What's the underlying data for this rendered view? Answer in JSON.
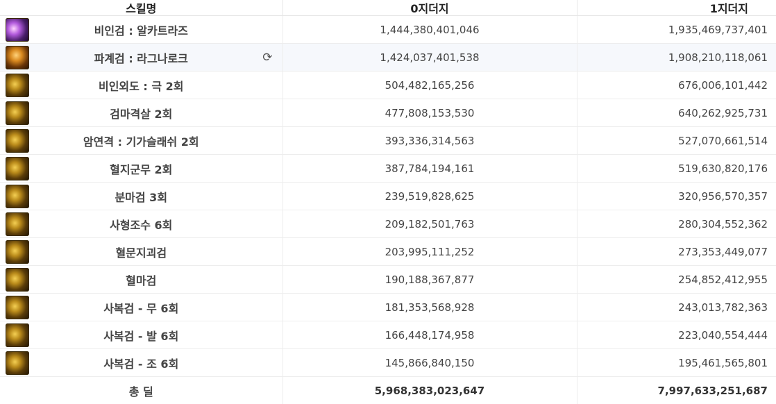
{
  "header": {
    "col_skill": "스킬명",
    "col_dist0": "0지더지",
    "col_dist1": "1지더지"
  },
  "rows": [
    {
      "name": "비인검 : 알카트라즈",
      "icon": "purple-sword-icon",
      "v0": "1,444,380,401,046",
      "v1": "1,935,469,737,401"
    },
    {
      "name": "파계검 : 라그나로크",
      "icon": "ragnarok-icon",
      "v0": "1,424,037,401,538",
      "v1": "1,908,210,118,061"
    },
    {
      "name": "비인외도 : 극 2회",
      "icon": "gold-slash-icon",
      "v0": "504,482,165,256",
      "v1": "676,006,101,442"
    },
    {
      "name": "검마격살 2회",
      "icon": "gold-claw-icon",
      "v0": "477,808,153,530",
      "v1": "640,262,925,731"
    },
    {
      "name": "암연격 : 기가슬래쉬 2회",
      "icon": "gold-dash-icon",
      "v0": "393,336,314,563",
      "v1": "527,070,661,514"
    },
    {
      "name": "혈지군무 2회",
      "icon": "gold-burst-icon",
      "v0": "387,784,194,161",
      "v1": "519,630,820,176"
    },
    {
      "name": "분마검 3회",
      "icon": "gold-blade-icon",
      "v0": "239,519,828,625",
      "v1": "320,956,570,357"
    },
    {
      "name": "사형조수 6회",
      "icon": "gold-arrows-icon",
      "v0": "209,182,501,763",
      "v1": "280,304,552,362"
    },
    {
      "name": "혈문지괴검",
      "icon": "gold-cross-icon",
      "v0": "203,995,111,252",
      "v1": "273,353,449,077"
    },
    {
      "name": "혈마검",
      "icon": "gold-swirl-icon",
      "v0": "190,188,367,877",
      "v1": "254,852,412,955"
    },
    {
      "name": "사복검 - 무 6회",
      "icon": "gold-crescent-icon",
      "v0": "181,353,568,928",
      "v1": "243,013,782,363"
    },
    {
      "name": "사복검 - 발 6회",
      "icon": "gold-spear-icon",
      "v0": "166,448,174,958",
      "v1": "223,040,554,444"
    },
    {
      "name": "사복검 - 조 6회",
      "icon": "gold-hook-icon",
      "v0": "145,866,840,150",
      "v1": "195,461,565,801"
    }
  ],
  "total": {
    "label": "총 딜",
    "v0": "5,968,383,023,647",
    "v1": "7,997,633,251,687"
  },
  "refresh_icon": "refresh-icon"
}
